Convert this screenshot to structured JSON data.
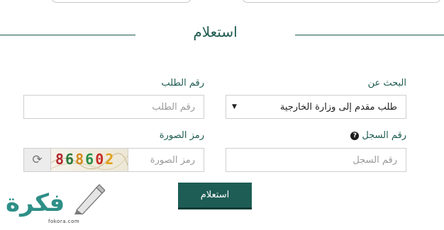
{
  "form": {
    "title": "استعلام",
    "search_by_label": "البحث عن",
    "search_by_value": "طلب مقدم إلى وزارة الخارجية",
    "request_no_label": "رقم الطلب",
    "request_no_placeholder": "رقم الطلب",
    "record_no_label": "رقم السجل",
    "record_no_placeholder": "رقم السجل",
    "captcha_label": "رمز الصورة",
    "captcha_placeholder": "رمز الصورة",
    "captcha_digits": [
      "8",
      "6",
      "8",
      "6",
      "0",
      "2"
    ],
    "submit_label": "استعلام"
  },
  "watermark": {
    "word": "فكرة",
    "domain": "fokora.com"
  },
  "colors": {
    "accent": "#1d5d55",
    "label": "#1d5a50",
    "logo": "#2e8f87"
  },
  "icons": {
    "help": "question-circle-icon",
    "refresh": "refresh-icon",
    "select_caret": "caret-down-icon"
  }
}
